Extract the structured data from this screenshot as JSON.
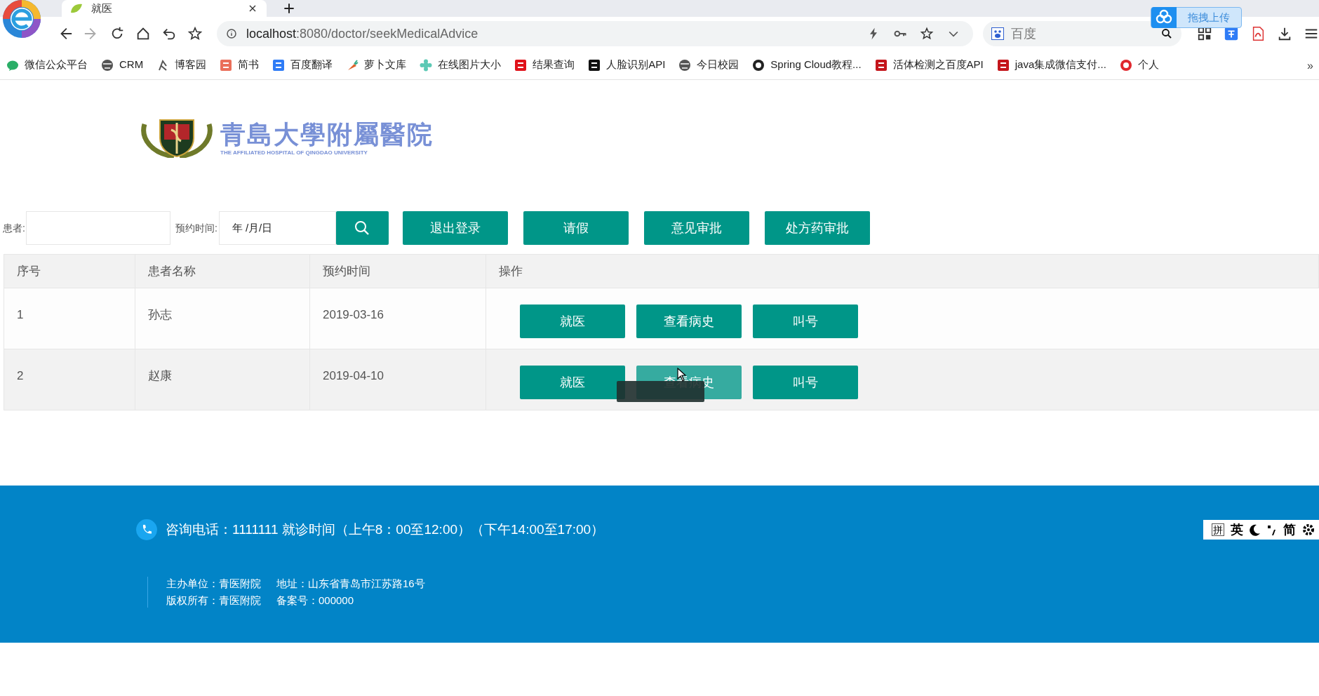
{
  "browser": {
    "tab_title": "就医",
    "url_host": "localhost",
    "url_path": ":8080/doctor/seekMedicalAdvice",
    "search_placeholder": "百度",
    "upload_widget": "拖拽上传",
    "bookmarks": [
      {
        "label": "微信公众平台"
      },
      {
        "label": "CRM"
      },
      {
        "label": "博客园"
      },
      {
        "label": "简书"
      },
      {
        "label": "百度翻译"
      },
      {
        "label": "萝卜文库"
      },
      {
        "label": "在线图片大小"
      },
      {
        "label": "结果查询"
      },
      {
        "label": "人脸识别API"
      },
      {
        "label": "今日校园"
      },
      {
        "label": "Spring Cloud教程..."
      },
      {
        "label": "活体检测之百度API"
      },
      {
        "label": "java集成微信支付..."
      },
      {
        "label": "个人"
      }
    ],
    "more": "»"
  },
  "logo": {
    "name": "青島大學附屬醫院",
    "subtitle": "THE AFFILIATED HOSPITAL OF QINGDAO UNIVERSITY"
  },
  "search": {
    "patient_label": "患者:",
    "date_label": "预约时间:",
    "date_value": "年 /月/日",
    "buttons": [
      "退出登录",
      "请假",
      "意见审批",
      "处方药审批"
    ]
  },
  "table": {
    "columns": [
      "序号",
      "患者名称",
      "预约时间",
      "操作"
    ],
    "rows": [
      {
        "cells": [
          "1",
          "孙志",
          "2019-03-16"
        ],
        "actions": [
          {
            "label": "就医",
            "hovered": false
          },
          {
            "label": "查看病史",
            "hovered": false
          },
          {
            "label": "叫号",
            "hovered": false
          }
        ]
      },
      {
        "cells": [
          "2",
          "赵康",
          "2019-04-10"
        ],
        "actions": [
          {
            "label": "就医",
            "hovered": false
          },
          {
            "label": "查看病史",
            "hovered": true
          },
          {
            "label": "叫号",
            "hovered": false
          }
        ]
      }
    ]
  },
  "footer": {
    "contact": "咨询电话：1111111 就诊时间（上午8：00至12:00）（下午14:00至17:00）",
    "lines": [
      [
        "主办单位：青医附院",
        "地址：山东省青岛市江苏路16号"
      ],
      [
        "版权所有：青医附院",
        "备案号：000000"
      ]
    ]
  },
  "ime_toolbar": {
    "labels": [
      "拼",
      "英",
      "简"
    ]
  }
}
